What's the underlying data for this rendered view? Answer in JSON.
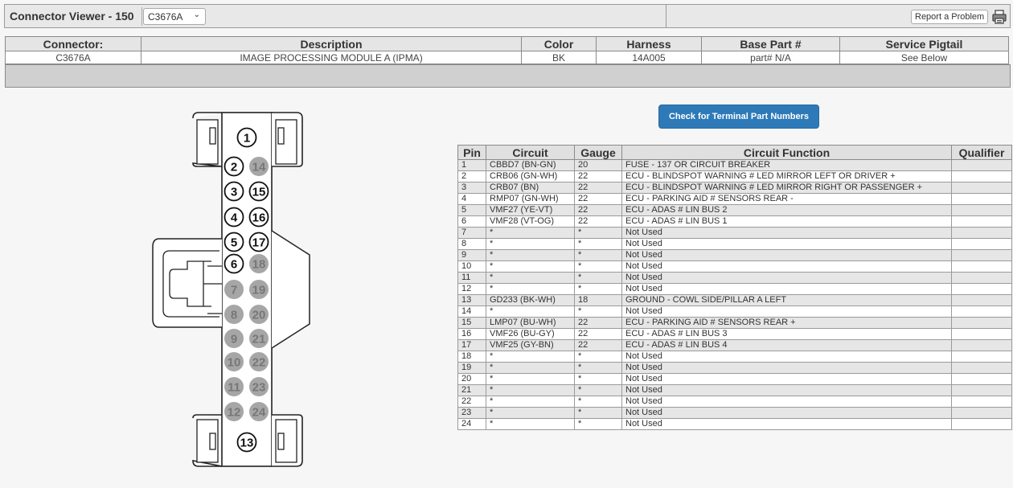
{
  "header": {
    "title": "Connector Viewer - 150",
    "connector_select": "C3676A",
    "report_label": "Report a Problem"
  },
  "connector_table": {
    "headers": [
      "Connector:",
      "Description",
      "Color",
      "Harness",
      "Base Part #",
      "Service Pigtail"
    ],
    "values": [
      "C3676A",
      "IMAGE PROCESSING MODULE A (IPMA)",
      "BK",
      "14A005",
      "part# N/A",
      "See Below"
    ]
  },
  "terminal_button": "Check for Terminal Part Numbers",
  "pin_table": {
    "headers": [
      "Pin",
      "Circuit",
      "Gauge",
      "Circuit Function",
      "Qualifier"
    ],
    "rows": [
      {
        "pin": "1",
        "circuit": "CBBD7 (BN-GN)",
        "gauge": "20",
        "function": "FUSE - 137 OR CIRCUIT BREAKER",
        "qualifier": ""
      },
      {
        "pin": "2",
        "circuit": "CRB06 (GN-WH)",
        "gauge": "22",
        "function": "ECU - BLINDSPOT WARNING # LED MIRROR LEFT OR DRIVER +",
        "qualifier": ""
      },
      {
        "pin": "3",
        "circuit": "CRB07 (BN)",
        "gauge": "22",
        "function": "ECU - BLINDSPOT WARNING # LED MIRROR RIGHT OR PASSENGER +",
        "qualifier": ""
      },
      {
        "pin": "4",
        "circuit": "RMP07 (GN-WH)",
        "gauge": "22",
        "function": "ECU - PARKING AID # SENSORS REAR -",
        "qualifier": ""
      },
      {
        "pin": "5",
        "circuit": "VMF27 (YE-VT)",
        "gauge": "22",
        "function": "ECU - ADAS # LIN BUS 2",
        "qualifier": ""
      },
      {
        "pin": "6",
        "circuit": "VMF28 (VT-OG)",
        "gauge": "22",
        "function": "ECU - ADAS # LIN BUS 1",
        "qualifier": ""
      },
      {
        "pin": "7",
        "circuit": "*",
        "gauge": "*",
        "function": "Not Used",
        "qualifier": ""
      },
      {
        "pin": "8",
        "circuit": "*",
        "gauge": "*",
        "function": "Not Used",
        "qualifier": ""
      },
      {
        "pin": "9",
        "circuit": "*",
        "gauge": "*",
        "function": "Not Used",
        "qualifier": ""
      },
      {
        "pin": "10",
        "circuit": "*",
        "gauge": "*",
        "function": "Not Used",
        "qualifier": ""
      },
      {
        "pin": "11",
        "circuit": "*",
        "gauge": "*",
        "function": "Not Used",
        "qualifier": ""
      },
      {
        "pin": "12",
        "circuit": "*",
        "gauge": "*",
        "function": "Not Used",
        "qualifier": ""
      },
      {
        "pin": "13",
        "circuit": "GD233 (BK-WH)",
        "gauge": "18",
        "function": "GROUND - COWL SIDE/PILLAR A LEFT",
        "qualifier": ""
      },
      {
        "pin": "14",
        "circuit": "*",
        "gauge": "*",
        "function": "Not Used",
        "qualifier": ""
      },
      {
        "pin": "15",
        "circuit": "LMP07 (BU-WH)",
        "gauge": "22",
        "function": "ECU - PARKING AID # SENSORS REAR +",
        "qualifier": ""
      },
      {
        "pin": "16",
        "circuit": "VMF26 (BU-GY)",
        "gauge": "22",
        "function": "ECU - ADAS # LIN BUS 3",
        "qualifier": ""
      },
      {
        "pin": "17",
        "circuit": "VMF25 (GY-BN)",
        "gauge": "22",
        "function": "ECU - ADAS # LIN BUS 4",
        "qualifier": ""
      },
      {
        "pin": "18",
        "circuit": "*",
        "gauge": "*",
        "function": "Not Used",
        "qualifier": ""
      },
      {
        "pin": "19",
        "circuit": "*",
        "gauge": "*",
        "function": "Not Used",
        "qualifier": ""
      },
      {
        "pin": "20",
        "circuit": "*",
        "gauge": "*",
        "function": "Not Used",
        "qualifier": ""
      },
      {
        "pin": "21",
        "circuit": "*",
        "gauge": "*",
        "function": "Not Used",
        "qualifier": ""
      },
      {
        "pin": "22",
        "circuit": "*",
        "gauge": "*",
        "function": "Not Used",
        "qualifier": ""
      },
      {
        "pin": "23",
        "circuit": "*",
        "gauge": "*",
        "function": "Not Used",
        "qualifier": ""
      },
      {
        "pin": "24",
        "circuit": "*",
        "gauge": "*",
        "function": "Not Used",
        "qualifier": ""
      }
    ]
  },
  "diagram": {
    "used_pins": [
      "1",
      "2",
      "3",
      "4",
      "5",
      "6",
      "13",
      "15",
      "16",
      "17"
    ],
    "unused_pins": [
      "7",
      "8",
      "9",
      "10",
      "11",
      "12",
      "14",
      "18",
      "19",
      "20",
      "21",
      "22",
      "23",
      "24"
    ],
    "used_color": "#ffffff",
    "unused_color": "#a6a6a6"
  },
  "colors": {
    "button_blue": "#2e7ab8",
    "header_grey": "#e5e5e5",
    "bar_grey": "#d0d0d0"
  }
}
